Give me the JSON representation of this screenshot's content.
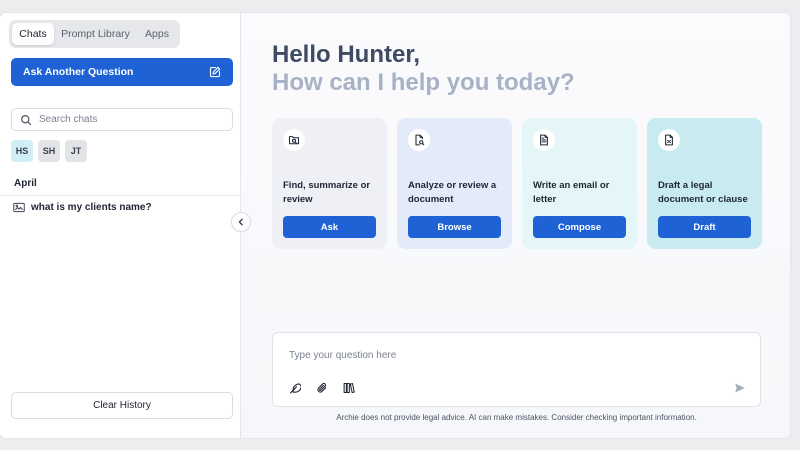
{
  "sidebar": {
    "tabs": [
      "Chats",
      "Prompt Library",
      "Apps"
    ],
    "active_tab": "Chats",
    "ask_button": "Ask Another Question",
    "search_placeholder": "Search chats",
    "avatars": [
      "HS",
      "SH",
      "JT"
    ],
    "section_label": "April",
    "chats": [
      "what is my clients name?"
    ],
    "clear_button": "Clear History"
  },
  "main": {
    "greeting_line1": "Hello Hunter,",
    "greeting_line2": "How can I help you today?",
    "cards": [
      {
        "icon": "search-doc-icon",
        "text": "Find, summarize or review",
        "button": "Ask"
      },
      {
        "icon": "doc-search-icon",
        "text": "Analyze or review a document",
        "button": "Browse"
      },
      {
        "icon": "document-icon",
        "text": "Write an email or letter",
        "button": "Compose"
      },
      {
        "icon": "legal-doc-icon",
        "text": "Draft a legal document or clause",
        "button": "Draft"
      }
    ],
    "composer_placeholder": "Type your question here",
    "tools": [
      "feather-icon",
      "paperclip-icon",
      "library-icon"
    ],
    "disclaimer": "Archie does not provide legal advice. AI can make mistakes. Consider checking important information."
  },
  "colors": {
    "accent": "#1f62d6",
    "greeting_primary": "#3f4a63",
    "greeting_secondary": "#a8b2c6"
  }
}
